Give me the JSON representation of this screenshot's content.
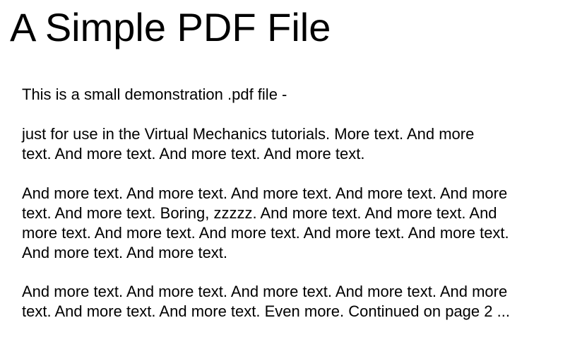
{
  "document": {
    "title": "A Simple PDF File",
    "paragraphs": [
      {
        "lines": [
          "This is a small demonstration .pdf file -"
        ]
      },
      {
        "lines": [
          "just for use in the Virtual Mechanics tutorials. More text. And more",
          "text. And more text. And more text. And more text."
        ]
      },
      {
        "lines": [
          "And more text. And more text. And more text. And more text. And more",
          "text. And more text. Boring, zzzzz. And more text. And more text. And",
          "more text. And more text. And more text. And more text. And more text.",
          "And more text. And more text."
        ]
      },
      {
        "lines": [
          "And more text. And more text. And more text. And more text. And more",
          "text. And more text. And more text. Even more. Continued on page 2 ..."
        ]
      }
    ]
  }
}
